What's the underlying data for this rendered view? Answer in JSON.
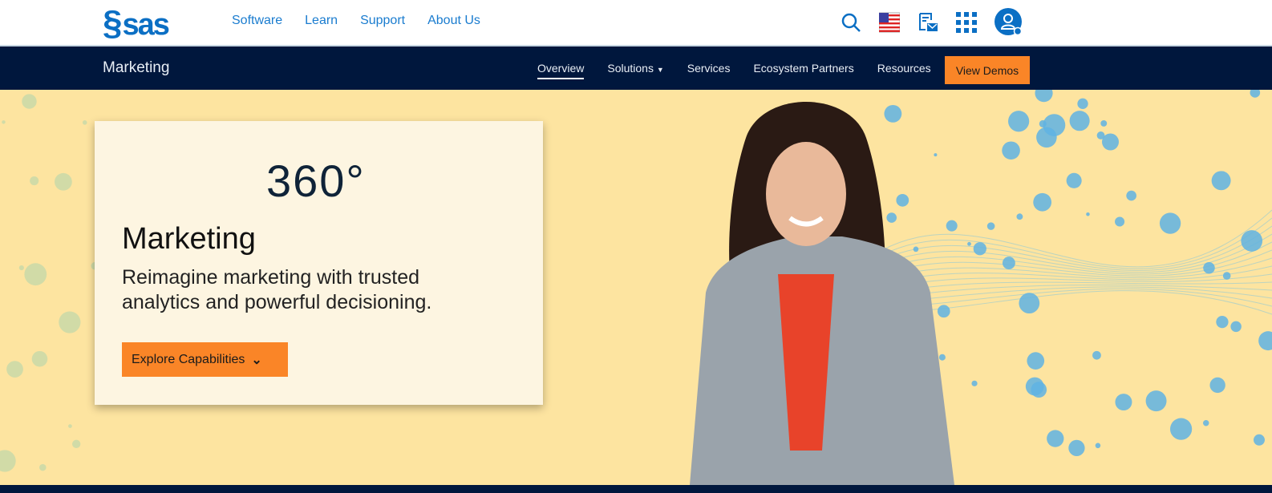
{
  "header": {
    "logo": "sas",
    "nav": [
      "Software",
      "Learn",
      "Support",
      "About Us"
    ],
    "icons": [
      "search-icon",
      "us-flag-icon",
      "newsletter-icon",
      "apps-grid-icon",
      "account-icon"
    ]
  },
  "subnav": {
    "title": "Marketing",
    "items": [
      "Overview",
      "Solutions",
      "Services",
      "Ecosystem Partners",
      "Resources"
    ],
    "active": "Overview",
    "cta": "View Demos"
  },
  "hero": {
    "logo_text": "360°",
    "title": "Marketing",
    "subtitle": "Reimagine marketing with trusted analytics and powerful decisioning.",
    "button": "Explore Capabilities"
  },
  "colors": {
    "brand_blue": "#0b6fc4",
    "navy": "#00173d",
    "orange": "#fa8527",
    "hero_bg": "#fde4a0"
  }
}
